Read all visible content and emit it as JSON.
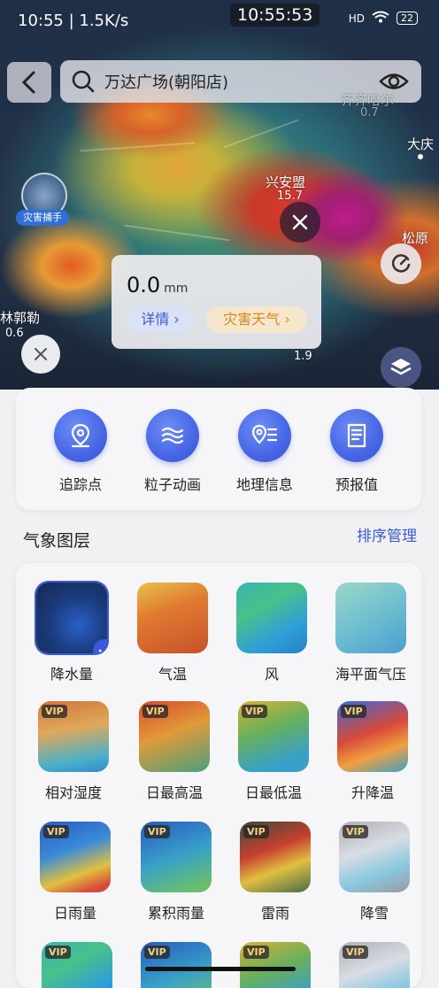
{
  "status_bar": {
    "time": "10:55 | 1.5K/s",
    "clock": "10:55:53",
    "hd": "HD",
    "battery": "22"
  },
  "search": {
    "query": "万达广场(朝阳店)"
  },
  "map": {
    "cities": [
      {
        "name": "齐齐哈尔",
        "value": "0.7"
      },
      {
        "name": "大庆",
        "value": ""
      },
      {
        "name": "兴安盟",
        "value": "15.7"
      },
      {
        "name": "松原",
        "value": ""
      },
      {
        "name": "林郭勒",
        "value": "0.6"
      }
    ],
    "extra_values": [
      "1.9"
    ],
    "disaster_label": "灾害捕手"
  },
  "popup": {
    "value": "0.0",
    "unit": "mm",
    "detail_label": "详情 ›",
    "warning_label": "灾害天气 ›"
  },
  "tools": [
    {
      "label": "追踪点",
      "icon": "location-pin-icon"
    },
    {
      "label": "粒子动画",
      "icon": "wind-waves-icon"
    },
    {
      "label": "地理信息",
      "icon": "geo-info-icon"
    },
    {
      "label": "预报值",
      "icon": "forecast-doc-icon"
    }
  ],
  "layers_section": {
    "title": "气象图层",
    "sort_label": "排序管理",
    "vip_text": "VIP",
    "items": [
      {
        "label": "降水量",
        "vip": false,
        "selected": true
      },
      {
        "label": "气温",
        "vip": false,
        "selected": false
      },
      {
        "label": "风",
        "vip": false,
        "selected": false
      },
      {
        "label": "海平面气压",
        "vip": false,
        "selected": false
      },
      {
        "label": "相对湿度",
        "vip": true,
        "selected": false
      },
      {
        "label": "日最高温",
        "vip": true,
        "selected": false
      },
      {
        "label": "日最低温",
        "vip": true,
        "selected": false
      },
      {
        "label": "升降温",
        "vip": true,
        "selected": false
      },
      {
        "label": "日雨量",
        "vip": true,
        "selected": false
      },
      {
        "label": "累积雨量",
        "vip": true,
        "selected": false
      },
      {
        "label": "雷雨",
        "vip": true,
        "selected": false
      },
      {
        "label": "降雪",
        "vip": true,
        "selected": false
      }
    ]
  }
}
